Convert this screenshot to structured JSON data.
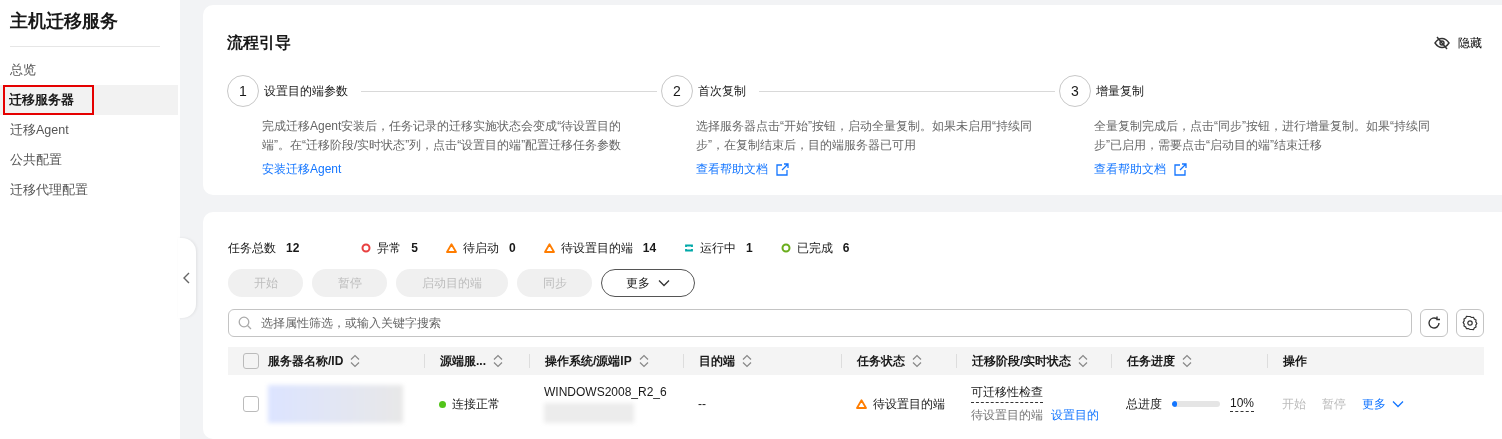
{
  "sidebar": {
    "title": "主机迁移服务",
    "items": [
      {
        "label": "总览",
        "selected": false,
        "annotated": false
      },
      {
        "label": "迁移服务器",
        "selected": true,
        "annotated": true
      },
      {
        "label": "迁移Agent",
        "selected": false,
        "annotated": false
      },
      {
        "label": "公共配置",
        "selected": false,
        "annotated": false
      },
      {
        "label": "迁移代理配置",
        "selected": false,
        "annotated": false
      }
    ]
  },
  "guide": {
    "title": "流程引导",
    "hide_label": "隐藏",
    "steps": [
      {
        "number": "1",
        "title": "设置目的端参数",
        "description": "完成迁移Agent安装后，任务记录的迁移实施状态会变成“待设置目的端”。在“迁移阶段/实时状态”列，点击“设置目的端”配置迁移任务参数",
        "link": {
          "label": "安装迁移Agent",
          "external": false
        }
      },
      {
        "number": "2",
        "title": "首次复制",
        "description": "选择服务器点击“开始”按钮，启动全量复制。如果未启用“持续同步”，在复制结束后，目的端服务器已可用",
        "link": {
          "label": "查看帮助文档",
          "external": true
        }
      },
      {
        "number": "3",
        "title": "增量复制",
        "description": "全量复制完成后，点击“同步”按钮，进行增量复制。如果“持续同步”已启用，需要点击“启动目的端”结束迁移",
        "link": {
          "label": "查看帮助文档",
          "external": true
        }
      }
    ]
  },
  "tasks": {
    "total_label": "任务总数",
    "total": "12",
    "stats": [
      {
        "kind": "ring",
        "label": "异常",
        "count": "5",
        "color": "#e84040"
      },
      {
        "kind": "triangle",
        "label": "待启动",
        "count": "0",
        "color": "#ff7d00"
      },
      {
        "kind": "triangle",
        "label": "待设置目的端",
        "count": "14",
        "color": "#ff7d00"
      },
      {
        "kind": "loop",
        "label": "运行中",
        "count": "1",
        "color": "#00a8a8"
      },
      {
        "kind": "ring",
        "label": "已完成",
        "count": "6",
        "color": "#6aad1c"
      }
    ],
    "buttons": [
      {
        "label": "开始",
        "disabled": true
      },
      {
        "label": "暂停",
        "disabled": true
      },
      {
        "label": "启动目的端",
        "disabled": true
      },
      {
        "label": "同步",
        "disabled": true
      }
    ],
    "more_button": "更多",
    "select_all_checked": false,
    "search": {
      "placeholder": "选择属性筛选，或输入关键字搜索"
    },
    "columns": [
      {
        "label": "服务器名称/ID",
        "sortable": true
      },
      {
        "label": "源端服...",
        "sortable": true
      },
      {
        "label": "操作系统/源端IP",
        "sortable": true
      },
      {
        "label": "目的端",
        "sortable": true
      },
      {
        "label": "任务状态",
        "sortable": true
      },
      {
        "label": "迁移阶段/实时状态",
        "sortable": true
      },
      {
        "label": "任务进度",
        "sortable": true
      },
      {
        "label": "操作",
        "sortable": false
      }
    ],
    "rows": [
      {
        "checked": false,
        "source": {
          "label": "连接正常",
          "color": "#52c41a"
        },
        "os": "WINDOWS2008_R2_6",
        "target": "--",
        "status": {
          "kind": "triangle",
          "label": "待设置目的端"
        },
        "stage": {
          "label": "可迁移性检查",
          "sub_label": "待设置目的端",
          "action": "设置目的"
        },
        "progress": {
          "label": "总进度",
          "level": 0.1,
          "reading": "10%"
        },
        "actions": [
          {
            "label": "开始",
            "disabled": true
          },
          {
            "label": "暂停",
            "disabled": true
          }
        ],
        "more": "更多"
      }
    ]
  }
}
